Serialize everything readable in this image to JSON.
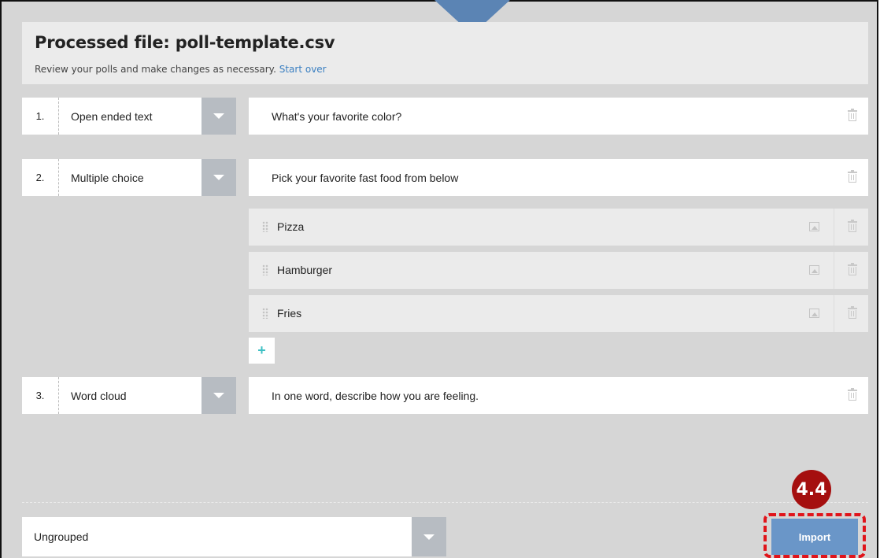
{
  "header": {
    "title": "Processed file: poll-template.csv",
    "subtitle": "Review your polls and make changes as necessary.",
    "start_over_link": "Start over"
  },
  "questions": [
    {
      "number": "1.",
      "type": "Open ended text",
      "text": "What's your favorite color?"
    },
    {
      "number": "2.",
      "type": "Multiple choice",
      "text": "Pick your favorite fast food from below",
      "options": [
        "Pizza",
        "Hamburger",
        "Fries"
      ]
    },
    {
      "number": "3.",
      "type": "Word cloud",
      "text": "In one word, describe how you are feeling."
    }
  ],
  "add_option_label": "+",
  "footer": {
    "group_select_value": "Ungrouped",
    "import_label": "Import",
    "step_badge": "4.4"
  },
  "colors": {
    "pointer_arrow": "#5b84b4",
    "import_button": "#6a96c8",
    "highlight_outline": "#e0141b",
    "step_badge": "#a50f0f",
    "add_icon": "#3fc0c4",
    "link": "#3a7fc1"
  }
}
